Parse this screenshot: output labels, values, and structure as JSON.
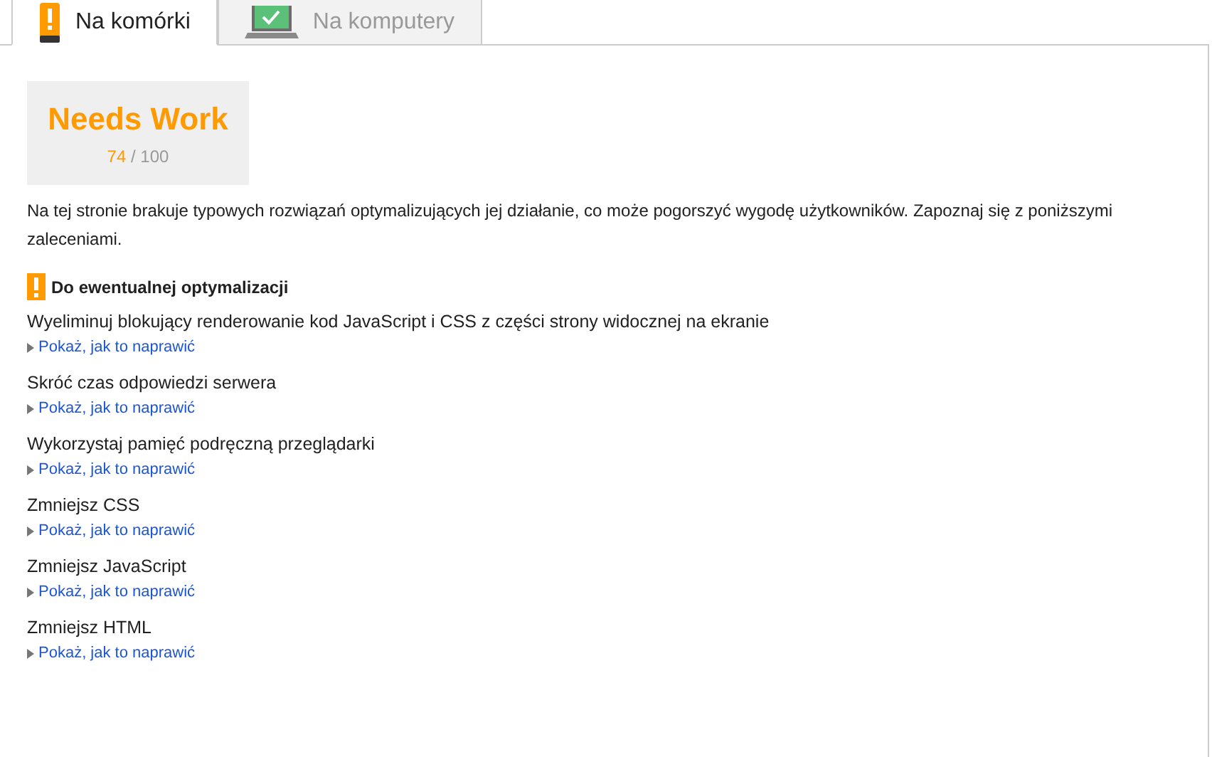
{
  "tabs": [
    {
      "label": "Na komórki",
      "kind": "mobile",
      "selected": true
    },
    {
      "label": "Na komputery",
      "kind": "desktop",
      "selected": false
    }
  ],
  "score": {
    "verdict": "Needs Work",
    "value": "74",
    "max": "/ 100",
    "color": "#ff9a00"
  },
  "summary": "Na tej stronie brakuje typowych rozwiązań optymalizujących jej działanie, co może pogorszyć wygodę użytkowników. Zapoznaj się z poniższymi zaleceniami.",
  "section": {
    "title": "Do ewentualnej optymalizacji",
    "rules": [
      {
        "title": "Wyeliminuj blokujący renderowanie kod JavaScript i CSS z części strony widocznej na ekranie",
        "link": "Pokaż, jak to naprawić",
        "expanded": false
      },
      {
        "title": "Skróć czas odpowiedzi serwera",
        "link": "Pokaż, jak to naprawić",
        "expanded": false
      },
      {
        "title": "Wykorzystaj pamięć podręczną przeglądarki",
        "link": "Pokaż, jak to naprawić",
        "expanded": false
      },
      {
        "title": "Zmniejsz CSS",
        "link": "Pokaż, jak to naprawić",
        "expanded": false
      },
      {
        "title": "Zmniejsz JavaScript",
        "link": "Pokaż, jak to naprawić",
        "expanded": false
      },
      {
        "title": "Zmniejsz HTML",
        "link": "Pokaż, jak to naprawić",
        "expanded": false
      }
    ]
  }
}
